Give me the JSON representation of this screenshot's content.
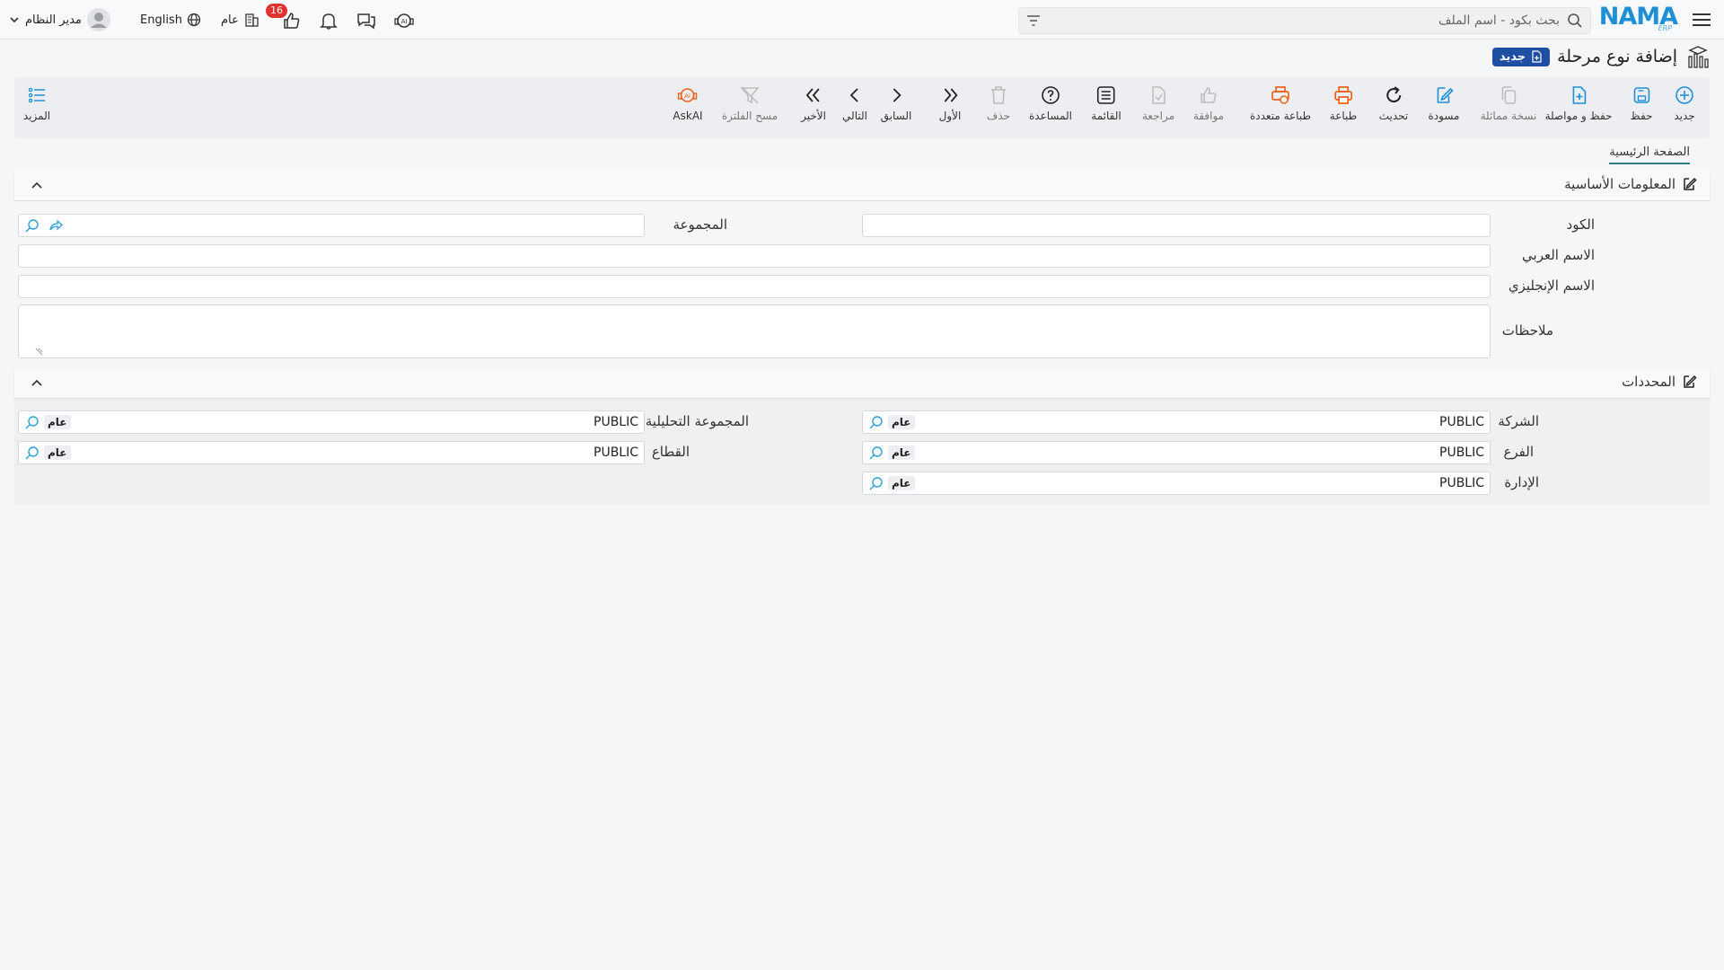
{
  "app": {
    "logo_text": "NAMA",
    "logo_sub": "ERP",
    "search_placeholder": "بحث بكود - اسم الملف",
    "user_name": "مدير النظام",
    "language": "English",
    "scope": "عام",
    "notification_count": "16"
  },
  "page": {
    "title": "إضافة نوع مرحلة",
    "mode_chip": "جديد"
  },
  "toolbar": {
    "items": [
      {
        "key": "new",
        "label": "جديد",
        "icon": "plus-circle-icon"
      },
      {
        "key": "save",
        "label": "حفظ",
        "icon": "save-icon"
      },
      {
        "key": "save_continue",
        "label": "حفظ و مواصلة",
        "icon": "file-plus-icon"
      },
      {
        "key": "duplicate",
        "label": "نسخة مماثلة",
        "icon": "copy-icon"
      },
      {
        "key": "draft",
        "label": "مسودة",
        "icon": "edit-icon"
      },
      {
        "key": "refresh",
        "label": "تحديث",
        "icon": "refresh-icon"
      },
      {
        "key": "print",
        "label": "طباعة",
        "icon": "printer-icon"
      },
      {
        "key": "multi_print",
        "label": "طباعة متعددة",
        "icon": "multi-printer-icon"
      },
      {
        "key": "approve",
        "label": "موافقة",
        "icon": "thumb-up-icon"
      },
      {
        "key": "review",
        "label": "مراجعة",
        "icon": "file-check-icon"
      },
      {
        "key": "list",
        "label": "القائمة",
        "icon": "list-icon"
      },
      {
        "key": "help",
        "label": "المساعدة",
        "icon": "help-icon"
      },
      {
        "key": "delete",
        "label": "حذف",
        "icon": "trash-icon"
      },
      {
        "key": "first",
        "label": "الأول",
        "icon": "double-chevron-right-icon"
      },
      {
        "key": "prev",
        "label": "السابق",
        "icon": "chevron-right-icon"
      },
      {
        "key": "next",
        "label": "التالي",
        "icon": "chevron-left-icon"
      },
      {
        "key": "last",
        "label": "الأخير",
        "icon": "double-chevron-left-icon"
      },
      {
        "key": "clear_filter",
        "label": "مسح الفلترة",
        "icon": "filter-off-icon"
      },
      {
        "key": "askai",
        "label": "AskAI",
        "icon": "ai-assistant-icon"
      }
    ],
    "more_label": "المزيد"
  },
  "tabs": {
    "main": "الصفحة الرئيسية"
  },
  "basic_info": {
    "title": "المعلومات الأساسية",
    "code_label": "الكود",
    "code_value": "",
    "group_label": "المجموعة",
    "group_value": "",
    "arabic_name_label": "الاسم العربي",
    "arabic_name_value": "",
    "english_name_label": "الاسم الإنجليزي",
    "english_name_value": "",
    "notes_label": "ملاحظات",
    "notes_value": ""
  },
  "dimensions": {
    "title": "المحددات",
    "company_label": "الشركة",
    "company_value": "PUBLIC",
    "company_tag": "عام",
    "analytic_group_label": "المجموعة التحليلية",
    "analytic_group_value": "PUBLIC",
    "analytic_group_tag": "عام",
    "branch_label": "الفرع",
    "branch_value": "PUBLIC",
    "branch_tag": "عام",
    "sector_label": "القطاع",
    "sector_value": "PUBLIC",
    "sector_tag": "عام",
    "department_label": "الإدارة",
    "department_value": "PUBLIC",
    "department_tag": "عام"
  }
}
